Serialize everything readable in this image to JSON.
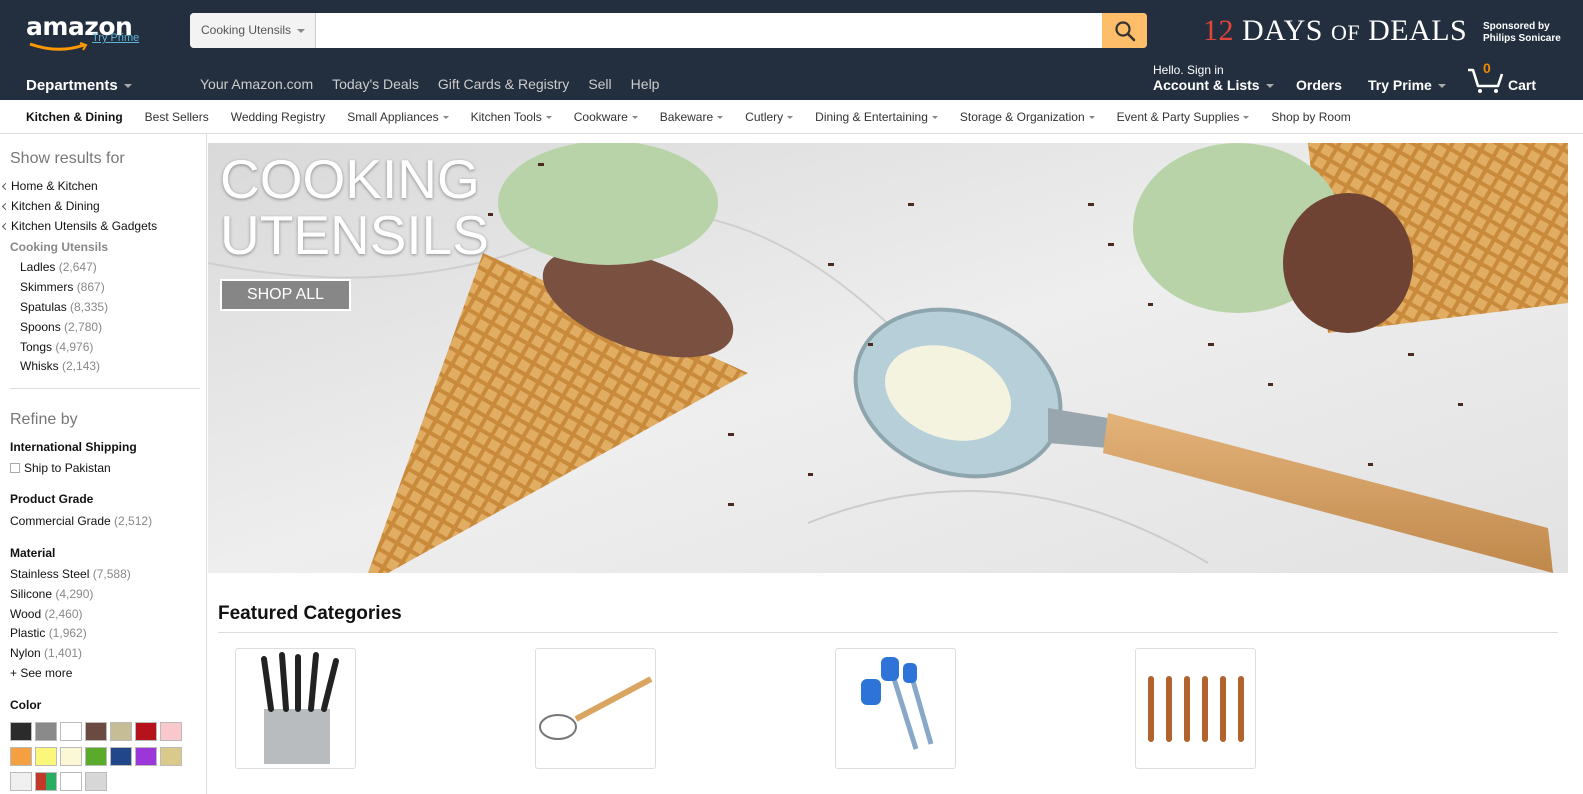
{
  "header": {
    "logo_text": "amazon",
    "try_prime": "Try Prime",
    "search": {
      "category": "Cooking Utensils",
      "value": "",
      "placeholder": ""
    },
    "promo": {
      "number": "12",
      "text1": "DAYS",
      "of": "OF",
      "text2": "DEALS",
      "sponsor_line1": "Sponsored by",
      "sponsor_line2": "Philips Sonicare"
    }
  },
  "nav": {
    "departments": "Departments",
    "links": [
      "Your Amazon.com",
      "Today's Deals",
      "Gift Cards & Registry",
      "Sell",
      "Help"
    ],
    "hello": "Hello. Sign in",
    "account": "Account & Lists",
    "orders": "Orders",
    "try_prime": "Try Prime",
    "cart_label": "Cart",
    "cart_count": "0"
  },
  "subnav": {
    "items": [
      {
        "label": "Kitchen & Dining",
        "bold": true,
        "caret": false
      },
      {
        "label": "Best Sellers",
        "bold": false,
        "caret": false
      },
      {
        "label": "Wedding Registry",
        "bold": false,
        "caret": false
      },
      {
        "label": "Small Appliances",
        "bold": false,
        "caret": true
      },
      {
        "label": "Kitchen Tools",
        "bold": false,
        "caret": true
      },
      {
        "label": "Cookware",
        "bold": false,
        "caret": true
      },
      {
        "label": "Bakeware",
        "bold": false,
        "caret": true
      },
      {
        "label": "Cutlery",
        "bold": false,
        "caret": true
      },
      {
        "label": "Dining & Entertaining",
        "bold": false,
        "caret": true
      },
      {
        "label": "Storage & Organization",
        "bold": false,
        "caret": true
      },
      {
        "label": "Event & Party Supplies",
        "bold": false,
        "caret": true
      },
      {
        "label": "Shop by Room",
        "bold": false,
        "caret": false
      }
    ]
  },
  "sidebar": {
    "show_results": "Show results for",
    "breadcrumbs": [
      "Home & Kitchen",
      "Kitchen & Dining",
      "Kitchen Utensils & Gadgets"
    ],
    "current": "Cooking Utensils",
    "subcategories": [
      {
        "label": "Ladles",
        "count": "(2,647)"
      },
      {
        "label": "Skimmers",
        "count": "(867)"
      },
      {
        "label": "Spatulas",
        "count": "(8,335)"
      },
      {
        "label": "Spoons",
        "count": "(2,780)"
      },
      {
        "label": "Tongs",
        "count": "(4,976)"
      },
      {
        "label": "Whisks",
        "count": "(2,143)"
      }
    ],
    "refine_by": "Refine by",
    "intl_shipping": "International Shipping",
    "ship_to": "Ship to Pakistan",
    "product_grade": "Product Grade",
    "grade_item": {
      "label": "Commercial Grade",
      "count": "(2,512)"
    },
    "material": "Material",
    "materials": [
      {
        "label": "Stainless Steel",
        "count": "(7,588)"
      },
      {
        "label": "Silicone",
        "count": "(4,290)"
      },
      {
        "label": "Wood",
        "count": "(2,460)"
      },
      {
        "label": "Plastic",
        "count": "(1,962)"
      },
      {
        "label": "Nylon",
        "count": "(1,401)"
      }
    ],
    "see_more": "+ See more",
    "color": "Color",
    "swatches": [
      "#2b2b2b",
      "#8a8a8a",
      "#ffffff",
      "#6b4a42",
      "#c6bd96",
      "#b5121b",
      "#f8c8cc",
      "#f5a040",
      "#faf77a",
      "#fcf8d6",
      "#5aaa2c",
      "#22468a",
      "#9b37d9",
      "#d9c98a",
      "#f0f0f0",
      "multi",
      "#ffffff",
      "#d7d7d7"
    ]
  },
  "hero": {
    "title_line1": "COOKING",
    "title_line2": "UTENSILS",
    "button": "SHOP ALL"
  },
  "featured": {
    "title": "Featured Categories"
  }
}
